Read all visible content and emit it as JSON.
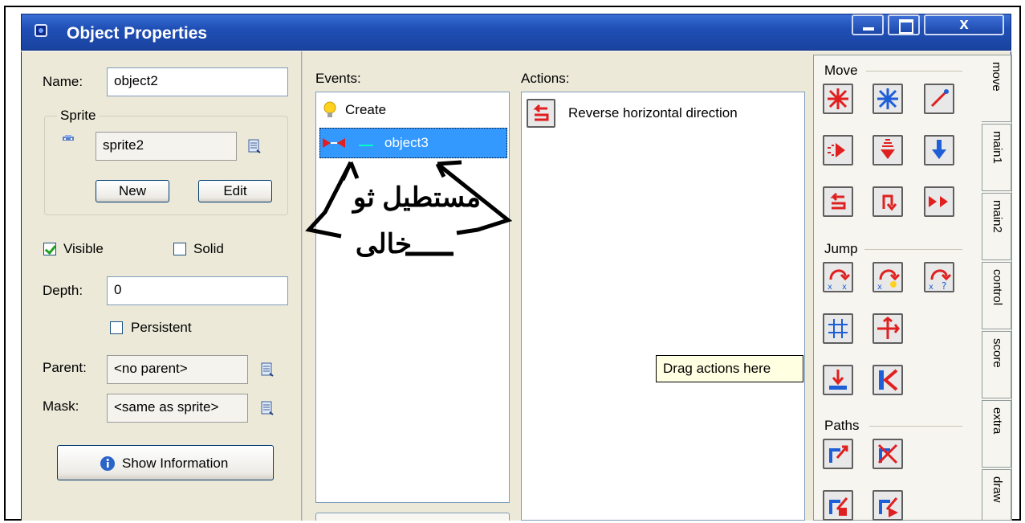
{
  "window": {
    "title": "Object Properties",
    "minimize_glyph": "",
    "maximize_glyph": "",
    "close_glyph": "x"
  },
  "left": {
    "name_label": "Name:",
    "name_value": "object2",
    "sprite_group_label": "Sprite",
    "sprite_value": "sprite2",
    "new_button": "New",
    "edit_button": "Edit",
    "visible_label": "Visible",
    "visible_checked": true,
    "solid_label": "Solid",
    "solid_checked": false,
    "depth_label": "Depth:",
    "depth_value": "0",
    "persistent_label": "Persistent",
    "persistent_checked": false,
    "parent_label": "Parent:",
    "parent_value": "<no parent>",
    "mask_label": "Mask:",
    "mask_value": "<same as sprite>",
    "show_info_button": "Show Information"
  },
  "events": {
    "label": "Events:",
    "items": [
      {
        "label": "Create",
        "icon": "lightbulb-icon",
        "selected": false
      },
      {
        "label": "object3",
        "icon": "collision-icon",
        "selected": true
      }
    ]
  },
  "actions": {
    "label": "Actions:",
    "items": [
      {
        "label": "Reverse horizontal direction",
        "icon": "reverse-horizontal-icon"
      }
    ],
    "drag_hint": "Drag actions here"
  },
  "annotation": {
    "line1": "مستطيل ثو",
    "line2": "خالى"
  },
  "palette": {
    "sections": [
      "Move",
      "Jump",
      "Paths"
    ],
    "tabs": [
      "move",
      "main1",
      "main2",
      "control",
      "score",
      "extra",
      "draw"
    ],
    "active_tab": "move"
  }
}
